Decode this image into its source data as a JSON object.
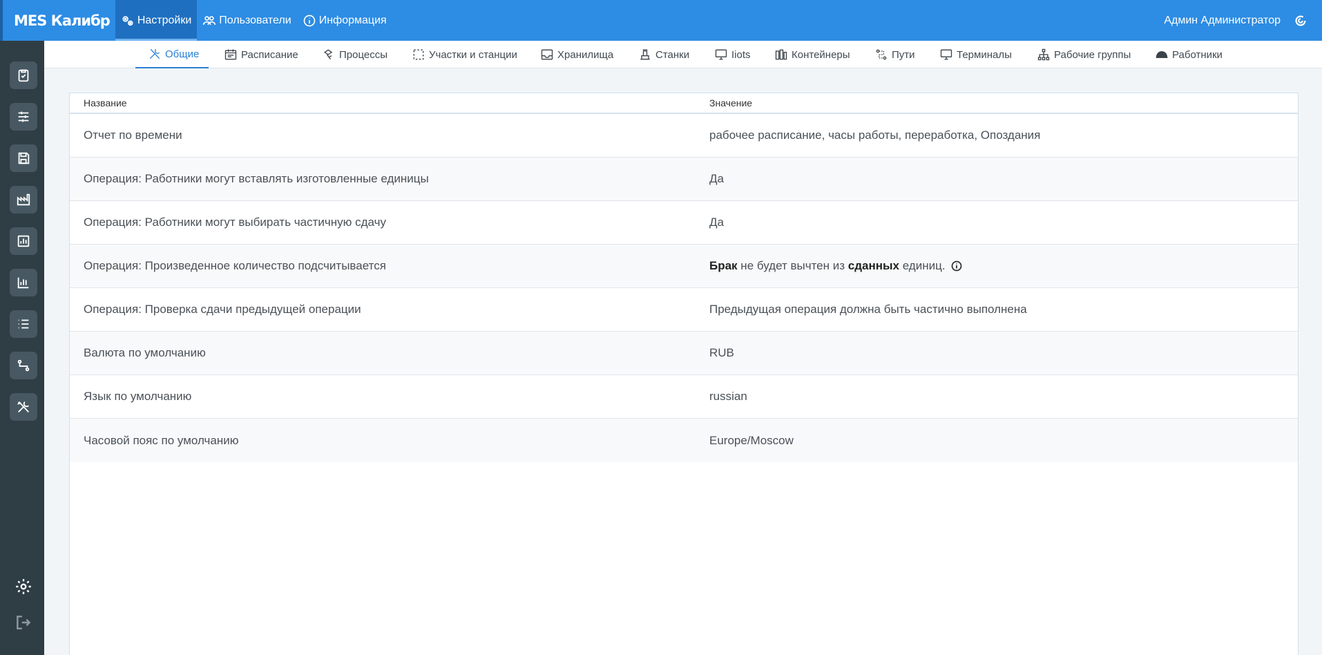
{
  "app": {
    "brand": "MES Калибр"
  },
  "topnav": [
    {
      "label": "Настройки",
      "icon": "gears-icon",
      "active": true
    },
    {
      "label": "Пользователи",
      "icon": "users-icon",
      "active": false
    },
    {
      "label": "Информация",
      "icon": "info-circle-icon",
      "active": false
    }
  ],
  "user": {
    "name": "Админ Администратор",
    "icon": "refresh-icon"
  },
  "sidebar": [
    {
      "name": "tasks",
      "icon": "clipboard-check-icon"
    },
    {
      "name": "planning",
      "icon": "sliders-icon"
    },
    {
      "name": "storage",
      "icon": "floppy-icon"
    },
    {
      "name": "factory",
      "icon": "factory-icon"
    },
    {
      "name": "reports",
      "icon": "bar-report-icon"
    },
    {
      "name": "analytics",
      "icon": "chart-icon"
    },
    {
      "name": "lists",
      "icon": "list-icon"
    },
    {
      "name": "routes",
      "icon": "route-icon"
    },
    {
      "name": "settings-tools",
      "icon": "tools-icon"
    }
  ],
  "subtabs": [
    {
      "label": "Общие",
      "icon": "tools-icon",
      "active": true
    },
    {
      "label": "Расписание",
      "icon": "calendar-icon",
      "active": false
    },
    {
      "label": "Процессы",
      "icon": "process-icon",
      "active": false
    },
    {
      "label": "Участки и станции",
      "icon": "area-icon",
      "active": false
    },
    {
      "label": "Хранилища",
      "icon": "inbox-icon",
      "active": false
    },
    {
      "label": "Станки",
      "icon": "machine-icon",
      "active": false
    },
    {
      "label": "Iiots",
      "icon": "monitor-icon",
      "active": false
    },
    {
      "label": "Контейнеры",
      "icon": "containers-icon",
      "active": false
    },
    {
      "label": "Пути",
      "icon": "path-icon",
      "active": false
    },
    {
      "label": "Терминалы",
      "icon": "monitor-icon",
      "active": false
    },
    {
      "label": "Рабочие группы",
      "icon": "hierarchy-icon",
      "active": false
    },
    {
      "label": "Работники",
      "icon": "helmet-icon",
      "active": false
    }
  ],
  "table": {
    "headers": {
      "name": "Название",
      "value": "Значение"
    },
    "rows": [
      {
        "name": "Отчет по времени",
        "value": "рабочее расписание, часы работы, переработка, Опоздания"
      },
      {
        "name": "Операция: Работники могут вставлять изготовленные единицы",
        "value": "Да"
      },
      {
        "name": "Операция: Работники могут выбирать частичную сдачу",
        "value": "Да"
      },
      {
        "name": "Операция: Произведенное количество подсчитывается",
        "value_parts": {
          "b1": "Брак",
          "t1": " не будет вычтен из ",
          "b2": "сданных",
          "t2": " единиц."
        }
      },
      {
        "name": "Операция: Проверка сдачи предыдущей операции",
        "value": "Предыдущая операция должна быть частично выполнена"
      },
      {
        "name": "Валюта по умолчанию",
        "value": "RUB"
      },
      {
        "name": "Язык по умолчанию",
        "value": "russian"
      },
      {
        "name": "Часовой пояс по умолчанию",
        "value": "Europe/Moscow"
      }
    ]
  }
}
